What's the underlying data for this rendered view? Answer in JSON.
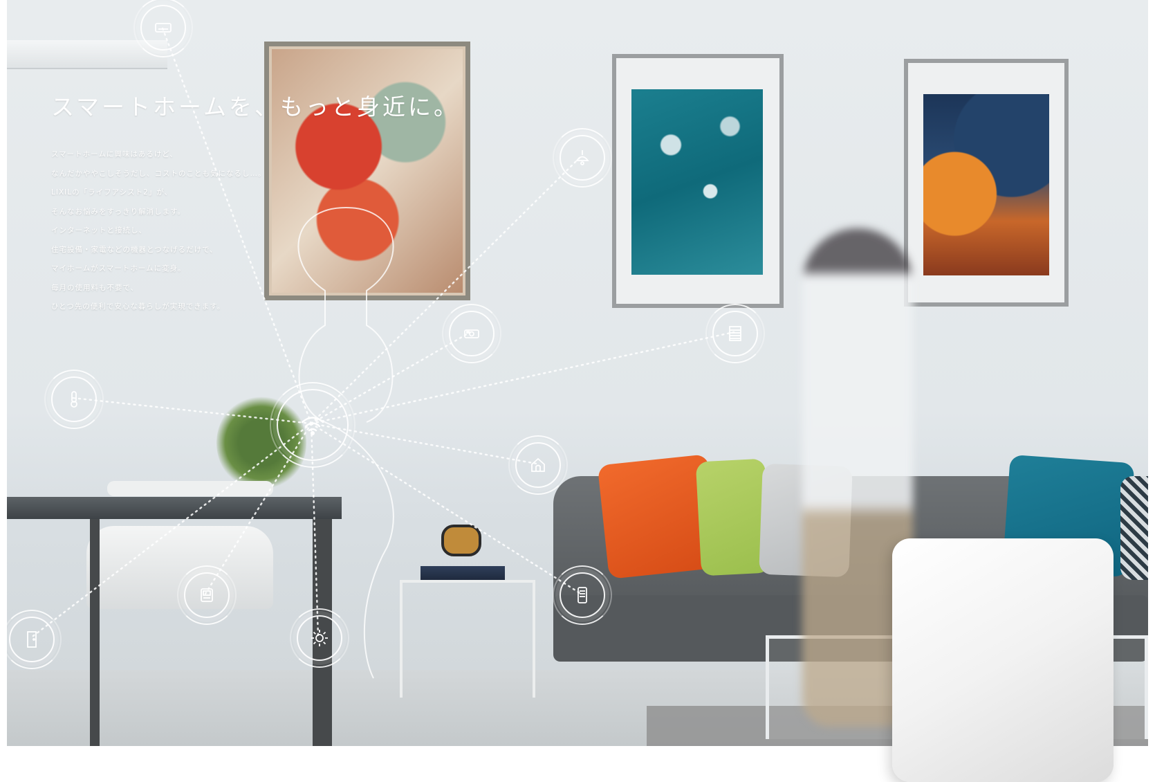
{
  "headline": "スマートホームを、もっと身近に。",
  "body_lines": [
    "スマートホームに興味はあるけど、",
    "なんだかややこしそうだし、コストのことも気になるし…。",
    "LIXILの「ライフアシスト2」が、",
    "そんなお悩みをすっきり解消します。",
    "インターネットと接続し、",
    "住宅設備・家電などの機器とつなげるだけで、",
    "マイホームがスマートホームに変身。",
    "毎月の使用料も不要で、",
    "ひとつ先の便利で安心な暮らしが実現できます。"
  ],
  "icons": [
    "air-conditioner-icon",
    "ceiling-light-icon",
    "camera-icon",
    "shutter-icon",
    "thermometer-icon",
    "wifi-icon",
    "home-icon",
    "appliance-icon",
    "door-icon",
    "sun-icon",
    "remote-icon"
  ],
  "colors": {
    "overlay_white": "#ffffff",
    "wall": "#e3e8eb",
    "accent_orange": "#f16a2c",
    "accent_teal": "#1f7f98"
  }
}
